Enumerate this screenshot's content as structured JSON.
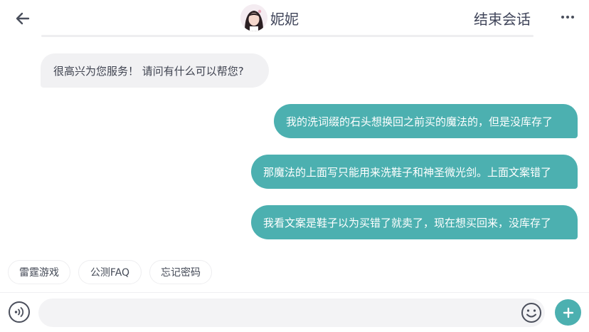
{
  "header": {
    "title": "妮妮",
    "end_label": "结束会话"
  },
  "messages": [
    {
      "side": "incoming",
      "text": "很高兴为您服务！ 请问有什么可以帮您?"
    },
    {
      "side": "outgoing",
      "text": "我的洗词缀的石头想换回之前买的魔法的，但是没库存了"
    },
    {
      "side": "outgoing",
      "text": "那魔法的上面写只能用来洗鞋子和神圣微光剑。上面文案错了"
    },
    {
      "side": "outgoing",
      "text": "我看文案是鞋子以为买错了就卖了，现在想买回来，没库存了"
    }
  ],
  "quick_replies": [
    "雷霆游戏",
    "公测FAQ",
    "忘记密码"
  ],
  "input": {
    "value": "",
    "placeholder": ""
  },
  "colors": {
    "accent": "#4cb0b0",
    "incoming_bubble": "#f1f1f3",
    "text": "#40455a"
  },
  "icons": {
    "back": "arrow-left-icon",
    "more": "more-dots-icon",
    "voice": "voice-icon",
    "emoji": "smile-icon",
    "plus": "plus-icon"
  }
}
